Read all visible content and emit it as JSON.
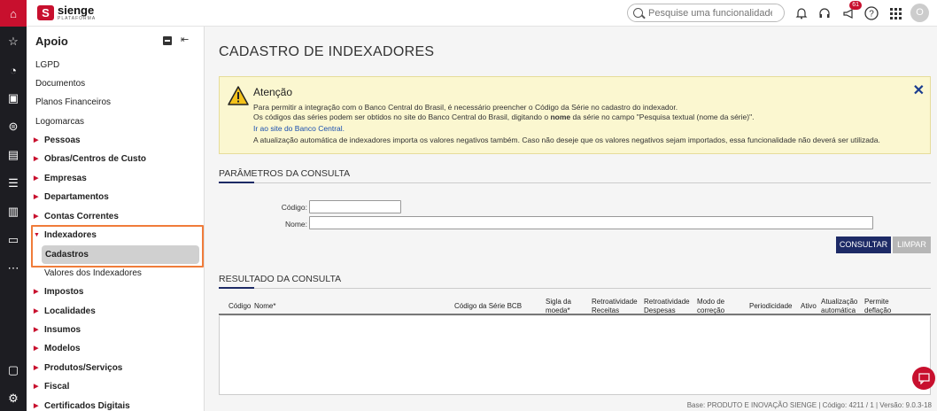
{
  "rail": {
    "icons": [
      "home-icon",
      "star-icon",
      "dashboard-icon",
      "box-icon",
      "coins-icon",
      "document-icon",
      "list-icon",
      "building-icon",
      "monitor-icon",
      "more-icon",
      "chat-icon",
      "settings-icon"
    ]
  },
  "topbar": {
    "logo_word": "sienge",
    "logo_sub": "PLATAFORMA",
    "search_placeholder": "Pesquise uma funcionalidade.",
    "notifications_badge": "61",
    "avatar_letter": "O"
  },
  "sidebar": {
    "title": "Apoio",
    "items": [
      {
        "label": "LGPD"
      },
      {
        "label": "Documentos"
      },
      {
        "label": "Planos Financeiros"
      },
      {
        "label": "Logomarcas"
      },
      {
        "label": "Pessoas"
      },
      {
        "label": "Obras/Centros de Custo"
      },
      {
        "label": "Empresas"
      },
      {
        "label": "Departamentos"
      },
      {
        "label": "Contas Correntes"
      },
      {
        "label": "Indexadores"
      },
      {
        "label": "Cadastros"
      },
      {
        "label": "Valores dos Indexadores"
      },
      {
        "label": "Impostos"
      },
      {
        "label": "Localidades"
      },
      {
        "label": "Insumos"
      },
      {
        "label": "Modelos"
      },
      {
        "label": "Produtos/Serviços"
      },
      {
        "label": "Fiscal"
      },
      {
        "label": "Certificados Digitais"
      }
    ]
  },
  "main": {
    "title": "CADASTRO DE INDEXADORES",
    "alert": {
      "title": "Atenção",
      "line1": "Para permitir a integração com o Banco Central do Brasil, é necessário preencher o Código da Série no cadastro do indexador.",
      "line2a": "Os códigos das séries podem ser obtidos no site do Banco Central do Brasil, digitando o ",
      "line2b": "nome",
      "line2c": " da série no campo \"Pesquisa textual (nome da série)\".",
      "link": "Ir ao site do Banco Central.",
      "line3": "A atualização automática de indexadores importa os valores negativos também. Caso não deseje que os valores negativos sejam importados, essa funcionalidade não deverá ser utilizada."
    },
    "params": {
      "title": "PARÂMETROS DA CONSULTA",
      "codigo_label": "Código:",
      "nome_label": "Nome:",
      "codigo_value": "",
      "nome_value": "",
      "consultar": "CONSULTAR",
      "limpar": "LIMPAR"
    },
    "result": {
      "title": "RESULTADO DA CONSULTA",
      "columns": [
        {
          "l1": "Código",
          "l2": ""
        },
        {
          "l1": "Nome*",
          "l2": ""
        },
        {
          "l1": "Código da Série BCB",
          "l2": ""
        },
        {
          "l1": "Sigla da",
          "l2": "moeda*"
        },
        {
          "l1": "Retroatividade",
          "l2": "Receitas"
        },
        {
          "l1": "Retroatividade",
          "l2": "Despesas"
        },
        {
          "l1": "Modo de",
          "l2": "correção"
        },
        {
          "l1": "Periodicidade",
          "l2": ""
        },
        {
          "l1": "Ativo",
          "l2": ""
        },
        {
          "l1": "Atualização",
          "l2": "automática"
        },
        {
          "l1": "Permite",
          "l2": "deflação"
        }
      ]
    },
    "footer": "Base: PRODUTO E INOVAÇÃO SIENGE | Código: 4211 / 1 | Versão: 9.0.3-18"
  }
}
